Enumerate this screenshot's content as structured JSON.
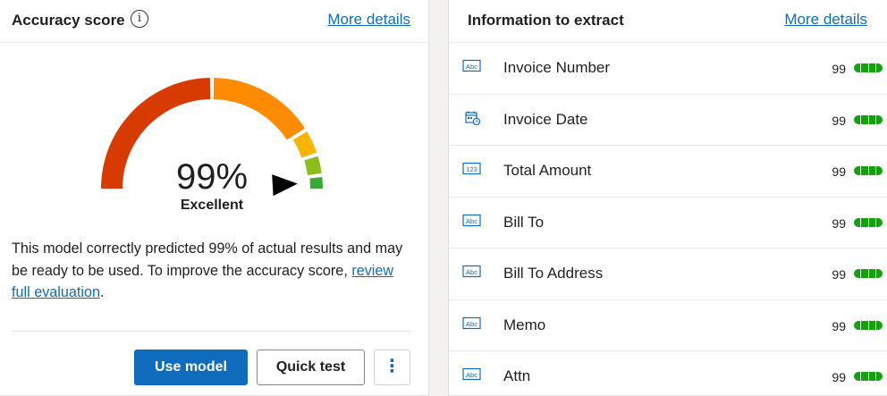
{
  "accuracy": {
    "title": "Accuracy score",
    "more_details": "More details",
    "score_text": "99%",
    "score_value": 99,
    "rating": "Excellent",
    "description": "This model correctly predicted 99% of actual results and may be ready to be used. To improve the accuracy score,",
    "evaluation_link": "review full evaluation",
    "description_end": ".",
    "gauge_colors": [
      "#d83b01",
      "#ff8c00",
      "#f7b500",
      "#8cbd18",
      "#3aa935"
    ]
  },
  "actions": {
    "use_model": "Use model",
    "quick_test": "Quick test",
    "more": "⋮"
  },
  "extract": {
    "title": "Information to extract",
    "more_details": "More details",
    "fields": [
      {
        "name": "Invoice Number",
        "type": "text",
        "icon": "text-field-icon",
        "score": "99"
      },
      {
        "name": "Invoice Date",
        "type": "date",
        "icon": "calendar-clock-icon",
        "score": "99"
      },
      {
        "name": "Total Amount",
        "type": "number",
        "icon": "number-field-icon",
        "score": "99"
      },
      {
        "name": "Bill To",
        "type": "text",
        "icon": "text-field-icon",
        "score": "99"
      },
      {
        "name": "Bill To Address",
        "type": "text",
        "icon": "text-field-icon",
        "score": "99"
      },
      {
        "name": "Memo",
        "type": "text",
        "icon": "text-field-icon",
        "score": "99"
      },
      {
        "name": "Attn",
        "type": "text",
        "icon": "text-field-icon",
        "score": "99"
      }
    ],
    "icon_text_label": "Abc",
    "icon_number_label": "123",
    "bar_color": "#13a10e"
  }
}
